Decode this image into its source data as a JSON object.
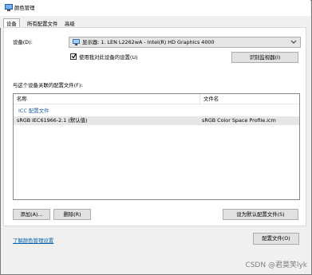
{
  "window": {
    "title": "颜色管理"
  },
  "tabs": [
    {
      "label": "设备"
    },
    {
      "label": "所有配置文件"
    },
    {
      "label": "高级"
    }
  ],
  "device": {
    "label": "设备(D):",
    "selected": "显示器: 1. LEN L2262wA - Intel(R) HD Graphics 4000",
    "use_my_settings_label": "使用我对此设备的设置(U)",
    "use_my_settings_checked": true,
    "identify_button": "识别监视器(I)"
  },
  "profiles": {
    "section_label": "与这个设备关联的配置文件(F):",
    "columns": [
      "名称",
      "文件名"
    ],
    "group_label": "ICC 配置文件",
    "rows": [
      {
        "name": "sRGB IEC61966-2.1 (默认值)",
        "file": "sRGB Color Space Profile.icm"
      }
    ]
  },
  "buttons": {
    "add": "添加(A)...",
    "delete": "删除(R)",
    "set_default": "设为默认配置文件(S)",
    "profiles": "配置文件(O)"
  },
  "footer": {
    "learn_link": "了解颜色管理设置",
    "watermark": "CSDN @君莫笑lyk"
  },
  "colors": {
    "accent_link": "#0063b1",
    "selection_row": "#e6e6e6",
    "button_face": "#e1e1e1"
  }
}
